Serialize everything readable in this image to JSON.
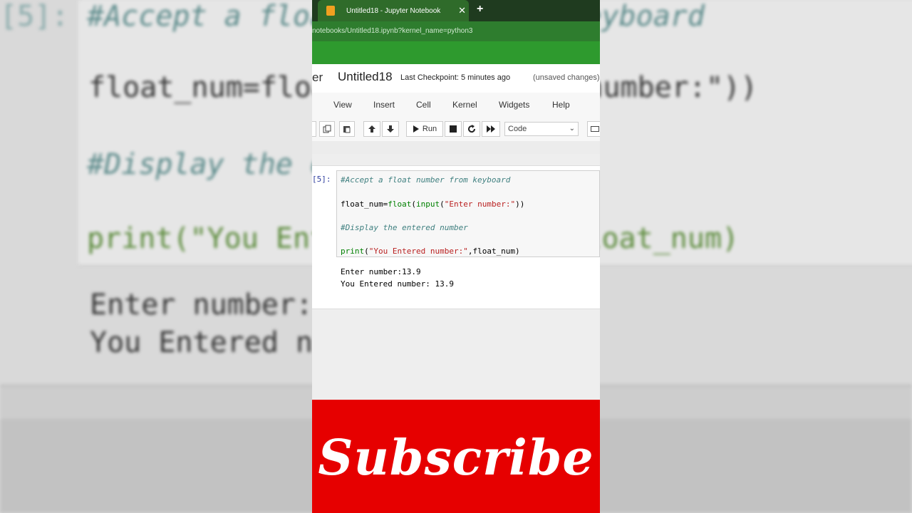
{
  "background_zoom": {
    "prompt": "[5]:",
    "lines": [
      "#Accept a float number from keyboard",
      "float_num=float(input(\"Enter number:\"))",
      "#Display the entered number",
      "print(\"You Entered number:\",float_num)"
    ],
    "output": [
      "Enter number:13.9",
      "You Entered number: 13.9"
    ]
  },
  "browser": {
    "tab_title": "Untitled18 - Jupyter Notebook",
    "tab_close": "✕",
    "new_tab": "+",
    "url": "notebooks/Untitled18.ipynb?kernel_name=python3"
  },
  "header": {
    "logo_fragment": "er",
    "notebook_title": "Untitled18",
    "checkpoint": "Last Checkpoint: 5 minutes ago",
    "unsaved": "(unsaved changes)"
  },
  "menu": [
    "View",
    "Insert",
    "Cell",
    "Kernel",
    "Widgets",
    "Help"
  ],
  "toolbar": {
    "run_label": "Run",
    "cell_type": "Code"
  },
  "cell": {
    "prompt": "[5]:",
    "comment1": "#Accept a float number from keyboard",
    "line2": {
      "var": "float_num=",
      "f1": "float",
      "p1": "(",
      "f2": "input",
      "p2": "(",
      "s": "\"Enter number:\"",
      "p3": "))"
    },
    "comment2": "#Display the entered number",
    "line4": {
      "f": "print",
      "p1": "(",
      "s": "\"You Entered number:\"",
      "rest": ",float_num)"
    },
    "output": [
      "Enter number:13.9",
      "You Entered number: 13.9"
    ]
  },
  "overlay": {
    "subscribe": "Subscribe",
    "subscribe_bg": "#e60000"
  }
}
